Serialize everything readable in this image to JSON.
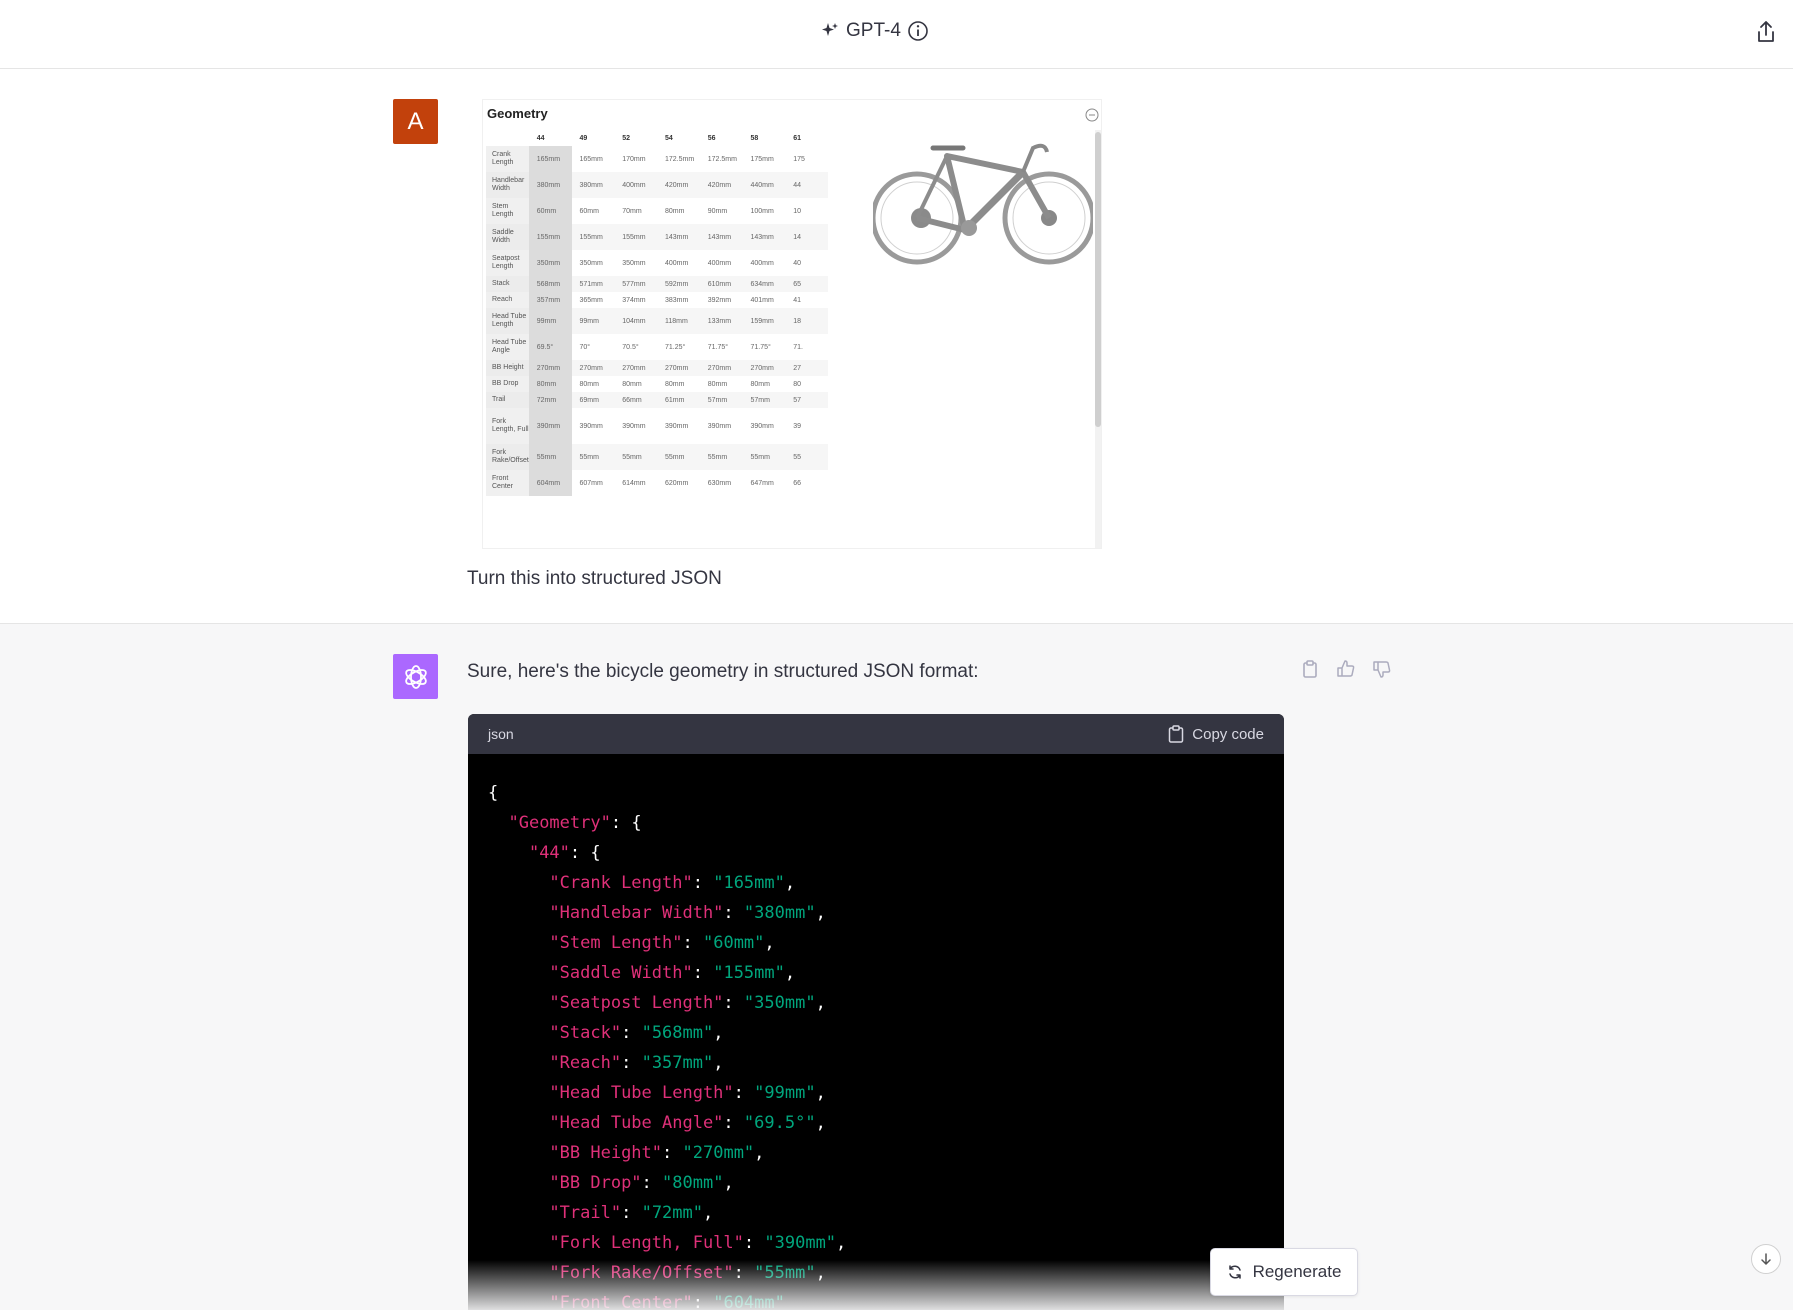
{
  "header": {
    "model_name": "GPT-4"
  },
  "user_message": {
    "avatar_letter": "A",
    "text": "Turn this into structured JSON",
    "image": {
      "title": "Geometry",
      "sizes": [
        "44",
        "49",
        "52",
        "54",
        "56",
        "58",
        "61"
      ],
      "rows": [
        {
          "label": "Crank Length",
          "values": [
            "165mm",
            "165mm",
            "170mm",
            "172.5mm",
            "172.5mm",
            "175mm",
            "175"
          ]
        },
        {
          "label": "Handlebar Width",
          "values": [
            "380mm",
            "380mm",
            "400mm",
            "420mm",
            "420mm",
            "440mm",
            "44"
          ]
        },
        {
          "label": "Stem Length",
          "values": [
            "60mm",
            "60mm",
            "70mm",
            "80mm",
            "90mm",
            "100mm",
            "10"
          ]
        },
        {
          "label": "Saddle Width",
          "values": [
            "155mm",
            "155mm",
            "155mm",
            "143mm",
            "143mm",
            "143mm",
            "14"
          ]
        },
        {
          "label": "Seatpost Length",
          "values": [
            "350mm",
            "350mm",
            "350mm",
            "400mm",
            "400mm",
            "400mm",
            "40"
          ]
        },
        {
          "label": "Stack",
          "values": [
            "568mm",
            "571mm",
            "577mm",
            "592mm",
            "610mm",
            "634mm",
            "65"
          ]
        },
        {
          "label": "Reach",
          "values": [
            "357mm",
            "365mm",
            "374mm",
            "383mm",
            "392mm",
            "401mm",
            "41"
          ]
        },
        {
          "label": "Head Tube Length",
          "values": [
            "99mm",
            "99mm",
            "104mm",
            "118mm",
            "133mm",
            "159mm",
            "18"
          ]
        },
        {
          "label": "Head Tube Angle",
          "values": [
            "69.5°",
            "70°",
            "70.5°",
            "71.25°",
            "71.75°",
            "71.75°",
            "71."
          ]
        },
        {
          "label": "BB Height",
          "values": [
            "270mm",
            "270mm",
            "270mm",
            "270mm",
            "270mm",
            "270mm",
            "27"
          ]
        },
        {
          "label": "BB Drop",
          "values": [
            "80mm",
            "80mm",
            "80mm",
            "80mm",
            "80mm",
            "80mm",
            "80"
          ]
        },
        {
          "label": "Trail",
          "values": [
            "72mm",
            "69mm",
            "66mm",
            "61mm",
            "57mm",
            "57mm",
            "57"
          ]
        },
        {
          "label": "Fork Length, Full",
          "values": [
            "390mm",
            "390mm",
            "390mm",
            "390mm",
            "390mm",
            "390mm",
            "39"
          ]
        },
        {
          "label": "Fork Rake/Offset",
          "values": [
            "55mm",
            "55mm",
            "55mm",
            "55mm",
            "55mm",
            "55mm",
            "55"
          ]
        },
        {
          "label": "Front Center",
          "values": [
            "604mm",
            "607mm",
            "614mm",
            "620mm",
            "630mm",
            "647mm",
            "66"
          ]
        }
      ]
    }
  },
  "assistant_message": {
    "text": "Sure, here's the bicycle geometry in structured JSON format:",
    "code": {
      "language": "json",
      "copy_label": "Copy code",
      "lines": [
        "{",
        "  \"Geometry\": {",
        "    \"44\": {",
        "      \"Crank Length\": \"165mm\",",
        "      \"Handlebar Width\": \"380mm\",",
        "      \"Stem Length\": \"60mm\",",
        "      \"Saddle Width\": \"155mm\",",
        "      \"Seatpost Length\": \"350mm\",",
        "      \"Stack\": \"568mm\",",
        "      \"Reach\": \"357mm\",",
        "      \"Head Tube Length\": \"99mm\",",
        "      \"Head Tube Angle\": \"69.5°\",",
        "      \"BB Height\": \"270mm\",",
        "      \"BB Drop\": \"80mm\",",
        "      \"Trail\": \"72mm\",",
        "      \"Fork Length, Full\": \"390mm\",",
        "      \"Fork Rake/Offset\": \"55mm\",",
        "      \"Front Center\": \"604mm\""
      ]
    }
  },
  "controls": {
    "regenerate_label": "Regenerate"
  },
  "colors": {
    "user_avatar": "#c2410c",
    "gpt_avatar": "#ab68ff",
    "json_key": "#df3079",
    "json_string": "#00a67d"
  },
  "icons": [
    "sparkle-icon",
    "info-icon",
    "share-icon",
    "collapse-icon",
    "clipboard-icon",
    "thumbs-up-icon",
    "thumbs-down-icon",
    "refresh-icon",
    "arrow-down-icon"
  ]
}
